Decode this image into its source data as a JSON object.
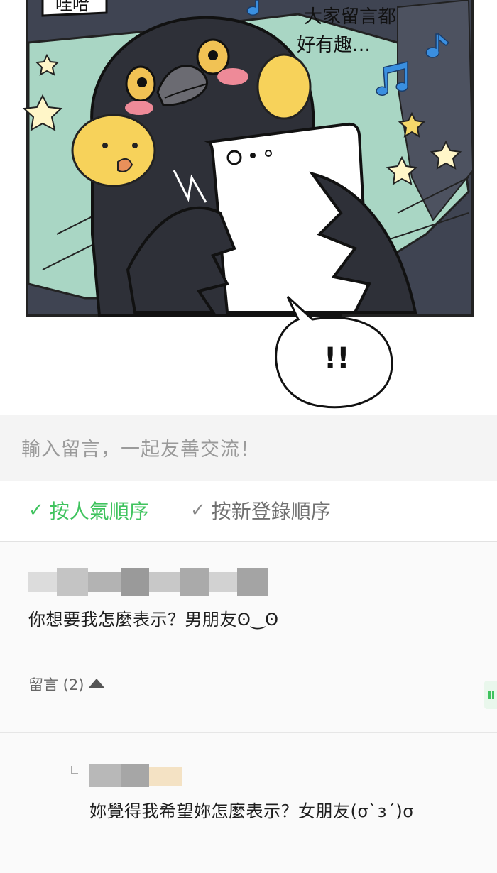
{
  "comic": {
    "speech_top_left": "哇哈",
    "speech_top_right": [
      "大家留言都",
      "好有趣…"
    ],
    "bubble_exclaim": "!!"
  },
  "comment_input": {
    "placeholder": "輸入留言，一起友善交流！"
  },
  "sort": {
    "popular_label": "按人氣順序",
    "newest_label": "按新登錄順序",
    "active": "popular",
    "accent_color": "#3fc35e"
  },
  "comment": {
    "author": "",
    "text": "你想要我怎麼表示？男朋友ʘ‿ʘ",
    "reply_toggle_label": "留言 (2)"
  },
  "reply": {
    "author": "",
    "text": "妳覺得我希望妳怎麼表示？女朋友(σ`з´)σ"
  }
}
